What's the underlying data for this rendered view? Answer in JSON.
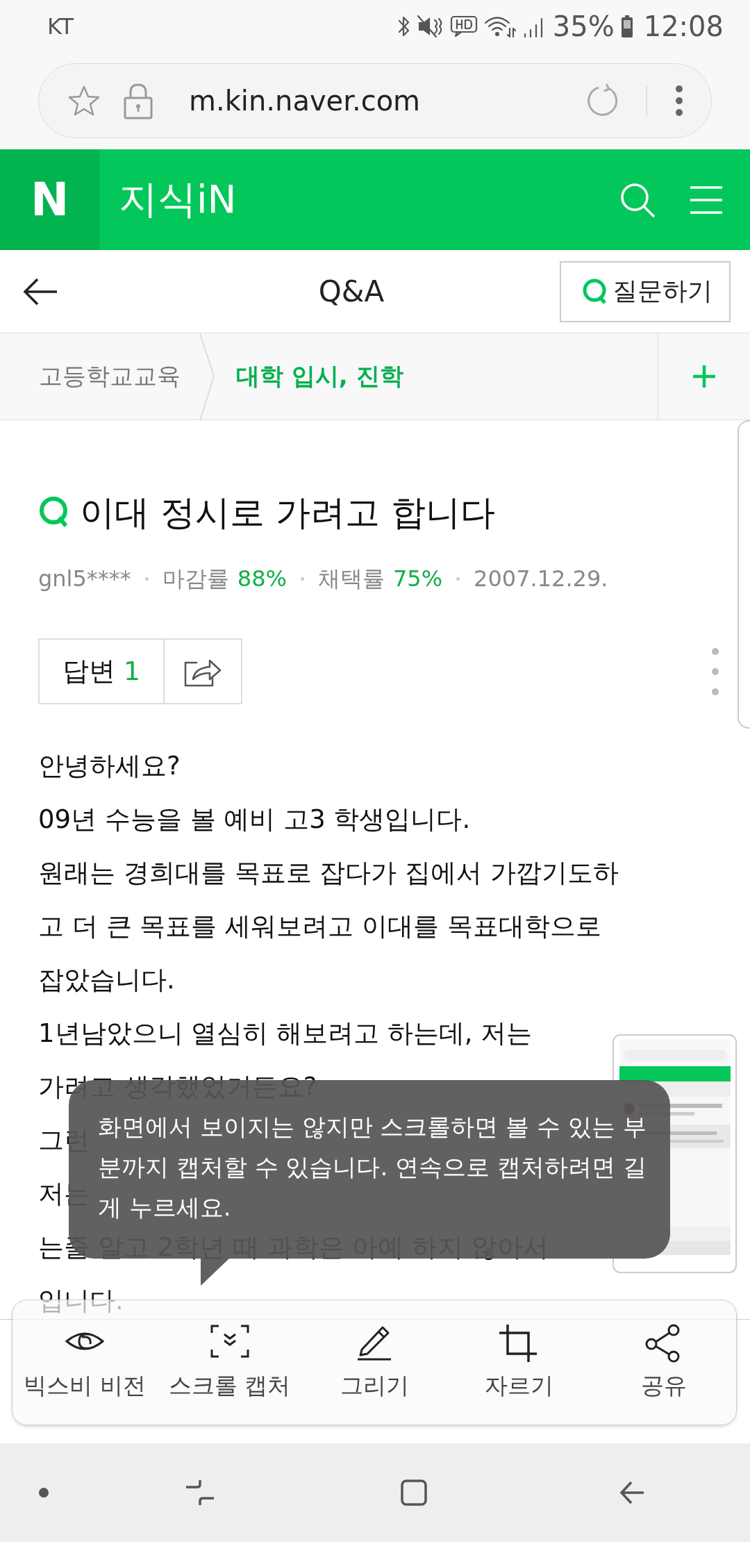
{
  "status_bar": {
    "carrier": "KT",
    "battery": "35%",
    "time": "12:08"
  },
  "browser": {
    "url": "m.kin.naver.com"
  },
  "header": {
    "logo": "N",
    "service": "지식iN"
  },
  "nav": {
    "title": "Q&A",
    "ask_button": "질문하기"
  },
  "breadcrumb": [
    {
      "label": "고등학교교육",
      "selected": false
    },
    {
      "label": "대학 입시, 진학",
      "selected": true
    }
  ],
  "question": {
    "title": "이대 정시로 가려고 합니다",
    "author": "gnl5****",
    "rates": [
      {
        "label": "마감률",
        "value": "88%"
      },
      {
        "label": "채택률",
        "value": "75%"
      }
    ],
    "date": "2007.12.29.",
    "answers_label": "답변",
    "answers_count": "1",
    "body": [
      [
        "안녕하세요?"
      ],
      [
        "09년 수능을 볼 예비 고3 학생입니다."
      ],
      [
        "원래는 경희대를 목표로 잡다가 집에서 가깝기도하"
      ],
      [
        "고 더 큰 목표를 세워보려고 이대를 목표대학으로"
      ],
      [
        "잡았습니다."
      ],
      [
        "1년남았으니 열심히 해보려고 하는데, 저는"
      ],
      [
        "가려고 생각했었거든요?"
      ],
      [
        "그런"
      ],
      [
        "저는"
      ],
      [
        "는줄 알고 2학년 때 과학은 아예 하지 않아서"
      ],
      [
        "입니다."
      ]
    ]
  },
  "tooltip": {
    "text": "화면에서 보이지는 않지만 스크롤하면 볼 수 있는 부분까지 캡처할 수 있습니다. 연속으로 캡처하려면 길게 누르세요."
  },
  "capture_toolbar": [
    {
      "kind": "bixby",
      "label": "빅스비 비전"
    },
    {
      "kind": "scroll",
      "label": "스크롤 캡처"
    },
    {
      "kind": "draw",
      "label": "그리기"
    },
    {
      "kind": "crop",
      "label": "자르기"
    },
    {
      "kind": "share",
      "label": "공유"
    }
  ],
  "system_nav": [
    {
      "kind": "dot"
    },
    {
      "kind": "recents"
    },
    {
      "kind": "home"
    },
    {
      "kind": "back"
    }
  ]
}
